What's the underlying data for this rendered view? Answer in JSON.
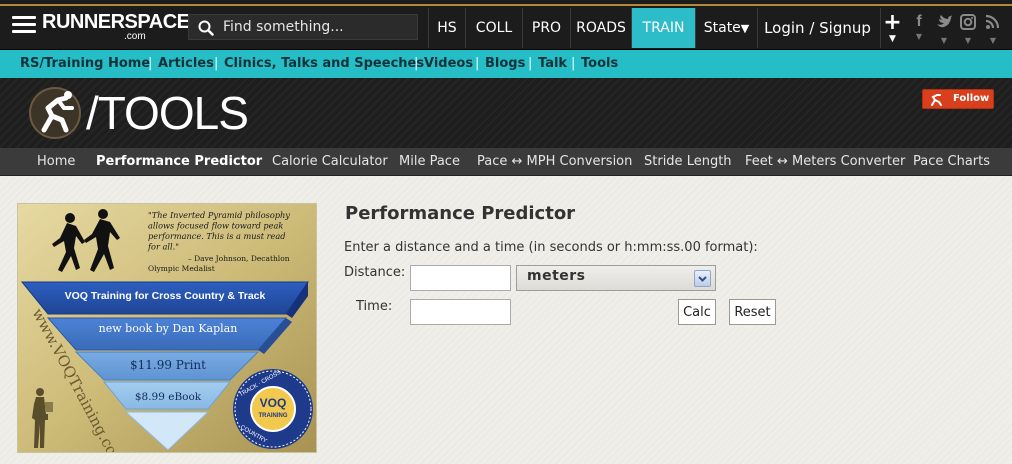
{
  "topbar": {
    "logo_main": "RUNNERSPACE",
    "logo_sub": ".com",
    "search_placeholder": "Find something...",
    "nav": [
      {
        "label": "HS"
      },
      {
        "label": "COLL"
      },
      {
        "label": "PRO"
      },
      {
        "label": "ROADS"
      },
      {
        "label": "TRAIN"
      },
      {
        "label": "State"
      }
    ],
    "active_nav": "TRAIN",
    "login_label": "Login / Signup",
    "plus_label": "+",
    "social": [
      "f",
      "t",
      "ig",
      "rss"
    ]
  },
  "subnav": {
    "items": [
      "RS/Training Home",
      "Articles",
      "Clinics, Talks and Speeches",
      "Videos",
      "Blogs",
      "Talk",
      "Tools"
    ],
    "separator": "|"
  },
  "banner": {
    "title": "/TOOLS",
    "follow_label": "Follow"
  },
  "toolsnav": {
    "items": [
      "Home",
      "Performance Predictor",
      "Calorie Calculator",
      "Mile Pace",
      "Pace ↔ MPH Conversion",
      "Stride Length",
      "Feet ↔ Meters Converter",
      "Pace Charts"
    ],
    "active": "Performance Predictor"
  },
  "ad": {
    "quote": "\"The Inverted Pyramid philosophy allows focused flow toward peak performance. This is a must read for all.\"",
    "attribution": "– Dave Johnson, Decathlon Olympic Medalist",
    "headline": "VOQ Training for Cross Country & Track",
    "tier2": "new book by Dan Kaplan",
    "tier3": "$11.99 Print",
    "tier4": "$8.99 eBook",
    "url": "www.VOQTraining.com",
    "seal_center": "VOQ TRAINING",
    "seal_ring": "TRACK · CROSS COUNTRY"
  },
  "form": {
    "title": "Performance Predictor",
    "instructions": "Enter a distance and a time (in seconds or h:mm:ss.00 format):",
    "distance_label": "Distance:",
    "distance_value": "",
    "unit_selected": "meters",
    "time_label": "Time:",
    "time_value": "",
    "calc_label": "Calc",
    "reset_label": "Reset"
  },
  "colors": {
    "topbar": "#1c1c1c",
    "accent_teal": "#25bdc6",
    "banner": "#1e1e1e",
    "follow": "#d8401d",
    "tools_nav": "#3b3b3b"
  }
}
